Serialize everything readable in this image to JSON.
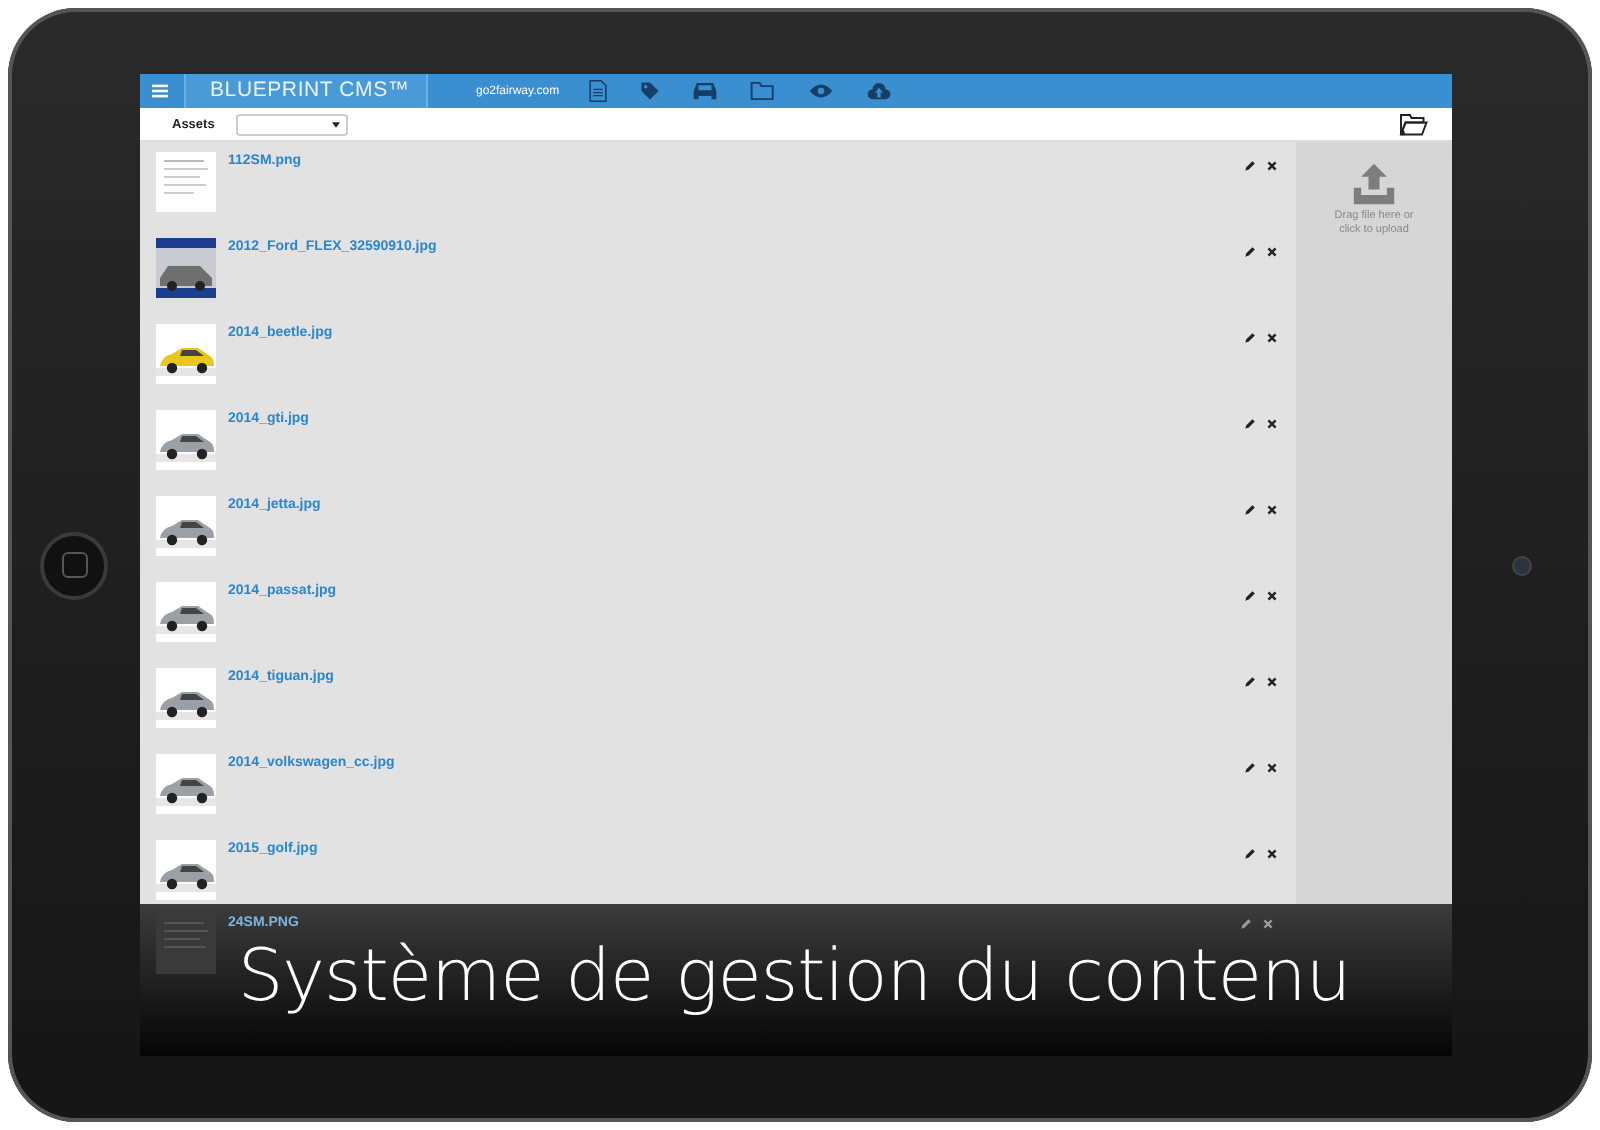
{
  "header": {
    "title": "BLUEPRINT CMS™",
    "domain": "go2fairway.com"
  },
  "toolbar": {
    "label": "Assets"
  },
  "assets": [
    {
      "name": "112SM.png"
    },
    {
      "name": "2012_Ford_FLEX_32590910.jpg"
    },
    {
      "name": "2014_beetle.jpg"
    },
    {
      "name": "2014_gti.jpg"
    },
    {
      "name": "2014_jetta.jpg"
    },
    {
      "name": "2014_passat.jpg"
    },
    {
      "name": "2014_tiguan.jpg"
    },
    {
      "name": "2014_volkswagen_cc.jpg"
    },
    {
      "name": "2015_golf.jpg"
    },
    {
      "name": "24SM.PNG"
    }
  ],
  "upload": {
    "text": "Drag file here or click to upload"
  },
  "caption": "Système de gestion du contenu"
}
